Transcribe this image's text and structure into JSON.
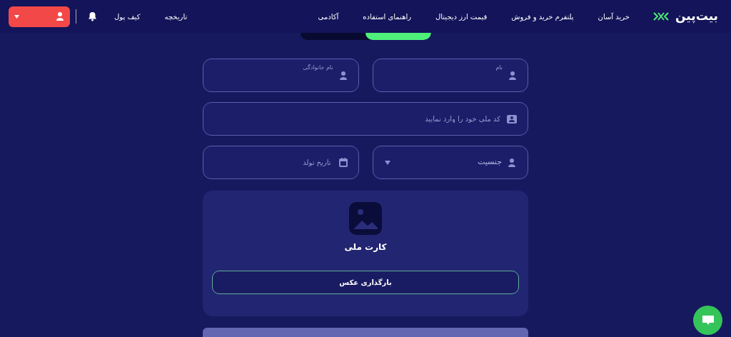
{
  "navbar": {
    "logo": "بیت‌پین",
    "links": [
      {
        "label": "خرید آسان"
      },
      {
        "label": "پلتفرم خرید و فروش"
      },
      {
        "label": "قیمت ارز دیجیتال"
      },
      {
        "label": "راهنمای استفاده"
      },
      {
        "label": "آکادمی"
      }
    ],
    "side_links": [
      {
        "label": "تاریخچه"
      },
      {
        "label": "کیف پول"
      }
    ]
  },
  "mode_toggle": {
    "segments": [
      {
        "selected": true
      },
      {
        "selected": false
      }
    ]
  },
  "form": {
    "fields": [
      {
        "kind": "text",
        "label": "نام"
      },
      {
        "kind": "text",
        "label": "نام خانوادگی"
      },
      {
        "kind": "wide",
        "placeholder": "کد ملی خود را وارد نمایید"
      },
      {
        "kind": "select",
        "value": "جنسیت"
      },
      {
        "kind": "text",
        "placeholder": "تاریخ تولد"
      }
    ],
    "upload": {
      "title": "کارت ملی",
      "button": "بارگذاری عکس"
    }
  }
}
